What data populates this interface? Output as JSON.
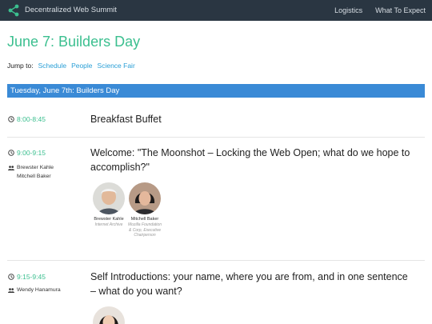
{
  "header": {
    "site_title": "Decentralized Web Summit",
    "nav": [
      "Logistics",
      "What To Expect"
    ]
  },
  "page": {
    "title": "June 7: Builders Day",
    "jump_label": "Jump to:",
    "jump_links": [
      "Schedule",
      "People",
      "Science Fair"
    ],
    "day_header": "Tuesday, June 7th: Builders Day"
  },
  "sessions": [
    {
      "time": "8:00-8:45",
      "title": "Breakfast Buffet",
      "people": []
    },
    {
      "time": "9:00-9:15",
      "title": "Welcome: \"The Moonshot – Locking the Web Open; what do we hope to accomplish?\"",
      "people": [
        "Brewster Kahle",
        "Mitchell Baker"
      ],
      "speakers": [
        {
          "name": "Brewster Kahle",
          "org": "Internet Archive"
        },
        {
          "name": "Mitchell Baker",
          "org": "Mozilla Foundation & Corp, Executive Chairperson"
        }
      ]
    },
    {
      "time": "9:15-9:45",
      "title": "Self Introductions: your name, where you are from, and in one sentence – what do you want?",
      "people": [
        "Wendy Hanamura"
      ]
    }
  ],
  "colors": {
    "topbar": "#2a3642",
    "accent_green": "#3bbf8f",
    "link_blue": "#2a9fd6",
    "day_band": "#3a8ad6"
  },
  "icons": {
    "logo": "share-icon",
    "time": "clock-icon",
    "people": "people-icon"
  }
}
